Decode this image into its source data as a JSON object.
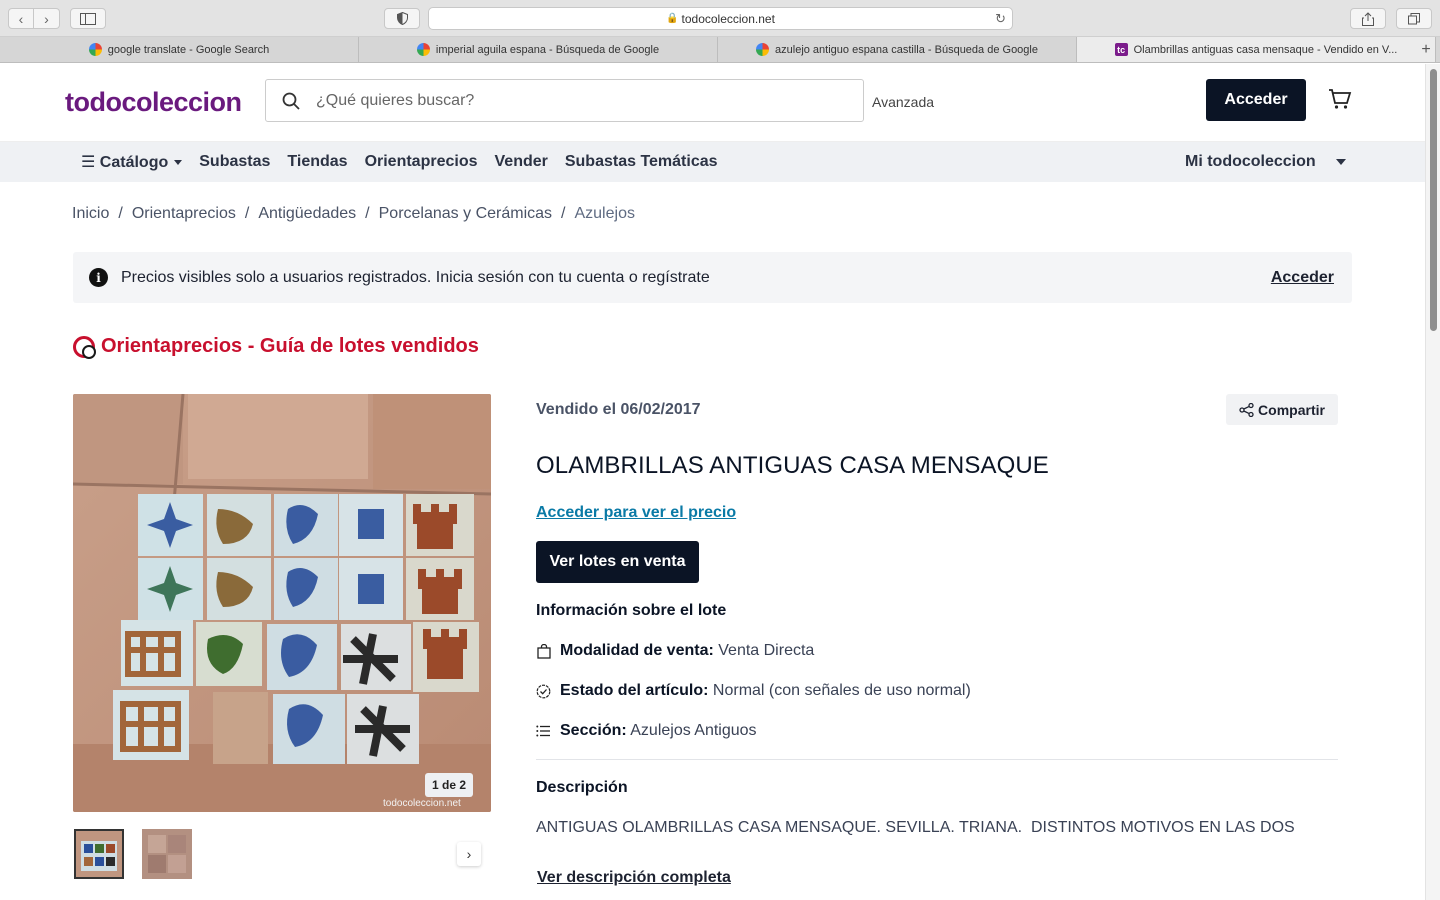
{
  "browser": {
    "url": "todocoleccion.net",
    "tabs": [
      {
        "title": "google translate - Google Search",
        "icon": "google-icon"
      },
      {
        "title": "imperial aguila espana - Búsqueda de Google",
        "icon": "google-icon"
      },
      {
        "title": "azulejo antiguo espana castilla - Búsqueda de Google",
        "icon": "google-icon"
      },
      {
        "title": "Olambrillas antiguas casa mensaque - Vendido en V...",
        "icon": "tc-icon",
        "favicon_text": "tc"
      }
    ]
  },
  "header": {
    "logo": "todocoleccion",
    "search_placeholder": "¿Qué quieres buscar?",
    "advanced": "Avanzada",
    "login": "Acceder"
  },
  "menu": {
    "items": [
      "Catálogo",
      "Subastas",
      "Tiendas",
      "Orientaprecios",
      "Vender",
      "Subastas Temáticas"
    ],
    "account": "Mi todocoleccion"
  },
  "breadcrumb": [
    "Inicio",
    "Orientaprecios",
    "Antigüedades",
    "Porcelanas y Cerámicas",
    "Azulejos"
  ],
  "notice": {
    "text": "Precios visibles solo a usuarios registrados. Inicia sesión con tu cuenta o regístrate",
    "link": "Acceder"
  },
  "section_title": "Orientaprecios - Guía de lotes vendidos",
  "gallery": {
    "counter": "1 de 2",
    "watermark": "todocoleccion.net"
  },
  "product": {
    "sold_date": "Vendido el 06/02/2017",
    "share": "Compartir",
    "title": "OLAMBRILLAS ANTIGUAS CASA MENSAQUE",
    "price_link": "Acceder para ver el precio",
    "view_lots": "Ver lotes en venta",
    "info_heading": "Información sobre el lote",
    "attributes": [
      {
        "label": "Modalidad de venta:",
        "value": "Venta Directa",
        "icon": "bag-icon"
      },
      {
        "label": "Estado del artículo:",
        "value": "Normal (con señales de uso normal)",
        "icon": "check-badge-icon"
      },
      {
        "label": "Sección:",
        "value": "Azulejos Antiguos",
        "icon": "list-icon"
      }
    ],
    "description_heading": "Descripción",
    "description": "ANTIGUAS OLAMBRILLAS CASA MENSAQUE. SEVILLA. TRIANA.  DISTINTOS MOTIVOS EN LAS DOS",
    "description_link": "Ver descripción completa"
  },
  "colors": {
    "brand": "#6a1a7e",
    "accent_red": "#c8102e",
    "dark_button": "#0b1425",
    "link_blue": "#0a7aa6"
  }
}
